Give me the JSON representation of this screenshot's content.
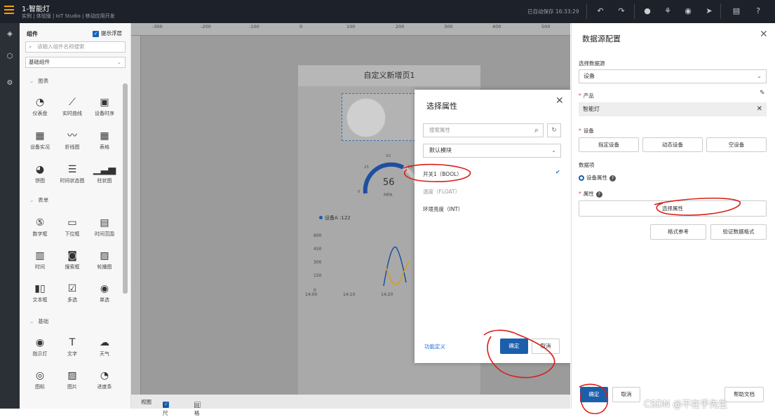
{
  "app": {
    "title": "1-智能灯",
    "breadcrumb": "实例 | 体验版 | IoT Studio | 移动应用开发",
    "save_status": "已自动保存 16:33:29"
  },
  "toolbar": {
    "icons": [
      "undo-icon",
      "redo-icon",
      "publish-icon",
      "share-icon",
      "preview-icon",
      "send-icon",
      "doc-icon",
      "help-icon"
    ]
  },
  "components": {
    "header": "组件",
    "show_float": "提示浮层",
    "search_placeholder": "请输入组件名称搜索",
    "category_select": "基础组件",
    "groups": [
      {
        "name": "图表",
        "items": [
          "仪表盘",
          "实时曲线",
          "设备时序",
          "设备实况",
          "折线图",
          "表格",
          "饼图",
          "时间状态图",
          "柱状图"
        ]
      },
      {
        "name": "表单",
        "items": [
          "数字框",
          "下拉框",
          "时间范围",
          "时间",
          "搜索框",
          "轮播图",
          "文本框",
          "多选",
          "单选"
        ]
      },
      {
        "name": "基础",
        "items": [
          "指示灯",
          "文字",
          "天气",
          "图标",
          "图片",
          "进度条"
        ]
      }
    ]
  },
  "canvas": {
    "ruler_marks": [
      "-300",
      "-200",
      "-100",
      "0",
      "100",
      "200",
      "300",
      "400",
      "500"
    ],
    "page_title": "自定义新增页1",
    "gauge": {
      "value": "56",
      "unit": "MPA",
      "ticks": [
        "0",
        "25",
        "50",
        "75"
      ]
    },
    "legend": "设备A :122",
    "y_ticks": [
      "600",
      "450",
      "300",
      "150",
      "0"
    ],
    "x_ticks": [
      "14:00",
      "14:10",
      "14:20"
    ],
    "bottom": {
      "view": "视图",
      "ruler": "标尺",
      "grid": "网格"
    }
  },
  "attr_dialog": {
    "title": "选择属性",
    "search_placeholder": "搜索属性",
    "module": "默认模块",
    "options": [
      "开关1（BOOL）",
      "温度（FLOAT）",
      "环境亮度（INT）"
    ],
    "func_link": "功能定义",
    "confirm": "确定",
    "cancel": "取消"
  },
  "panel": {
    "title": "数据源配置",
    "source_label": "选择数据源",
    "source_value": "设备",
    "product_label": "产品",
    "product_value": "智能灯",
    "device_label": "设备",
    "device_buttons": [
      "指定设备",
      "动态设备",
      "空设备"
    ],
    "data_label": "数据项",
    "data_radio": "设备属性",
    "attr_label": "属性",
    "attr_button": "选择属性",
    "format_ref": "格式参考",
    "verify": "验证数据格式",
    "confirm": "确定",
    "cancel": "取消",
    "help_doc": "帮助文档"
  },
  "watermark": "CSDN @不在乎先生"
}
